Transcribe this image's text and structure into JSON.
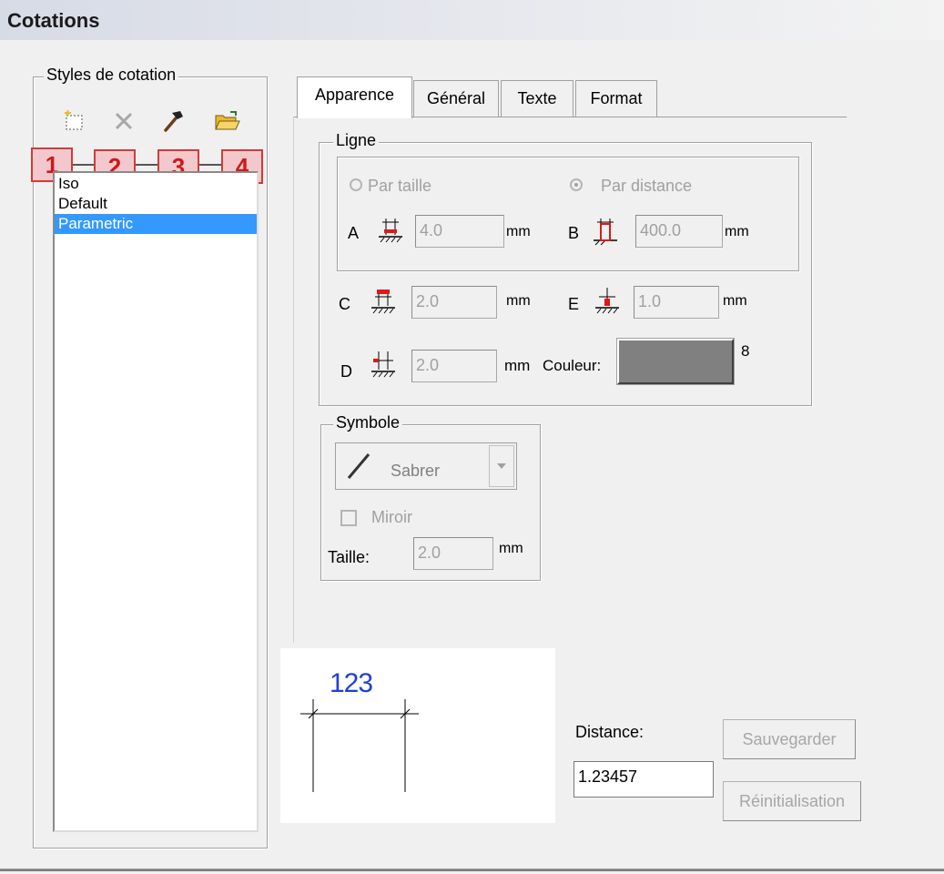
{
  "window": {
    "title": "Cotations"
  },
  "styles_group": {
    "legend": "Styles de cotation",
    "toolbar": [
      {
        "icon": "new-icon"
      },
      {
        "icon": "delete-icon"
      },
      {
        "icon": "hammer-icon"
      },
      {
        "icon": "open-folder-icon"
      }
    ],
    "callouts": [
      "1",
      "2",
      "3",
      "4"
    ],
    "list": {
      "items": [
        "Iso",
        "Default",
        "Parametric"
      ],
      "selected": "Parametric"
    }
  },
  "tabs": [
    {
      "label": "Apparence",
      "active": true
    },
    {
      "label": "Général",
      "active": false
    },
    {
      "label": "Texte",
      "active": false
    },
    {
      "label": "Format",
      "active": false
    }
  ],
  "ligne": {
    "legend": "Ligne",
    "radio_par_taille": "Par taille",
    "radio_par_distance": "Par distance",
    "selected": "Par distance",
    "A": {
      "label": "A",
      "value": "4.0",
      "unit": "mm"
    },
    "B": {
      "label": "B",
      "value": "400.0",
      "unit": "mm"
    },
    "C": {
      "label": "C",
      "value": "2.0",
      "unit": "mm"
    },
    "E": {
      "label": "E",
      "value": "1.0",
      "unit": "mm"
    },
    "D": {
      "label": "D",
      "value": "2.0",
      "unit": "mm"
    },
    "couleur": {
      "label": "Couleur:",
      "value": "8",
      "swatch": "#808080"
    }
  },
  "symbole": {
    "legend": "Symbole",
    "select_value": "Sabrer",
    "miroir_label": "Miroir",
    "miroir_checked": false,
    "taille_label": "Taille:",
    "taille_value": "2.0",
    "taille_unit": "mm"
  },
  "preview": {
    "dimension_text": "123"
  },
  "distance": {
    "label": "Distance:",
    "value": "1.23457"
  },
  "buttons": {
    "save": "Sauvegarder",
    "reset": "Réinitialisation"
  },
  "colors": {
    "selection": "#3399ff",
    "callout_border": "#d23a3a",
    "preview_text": "#1f3fd8"
  }
}
